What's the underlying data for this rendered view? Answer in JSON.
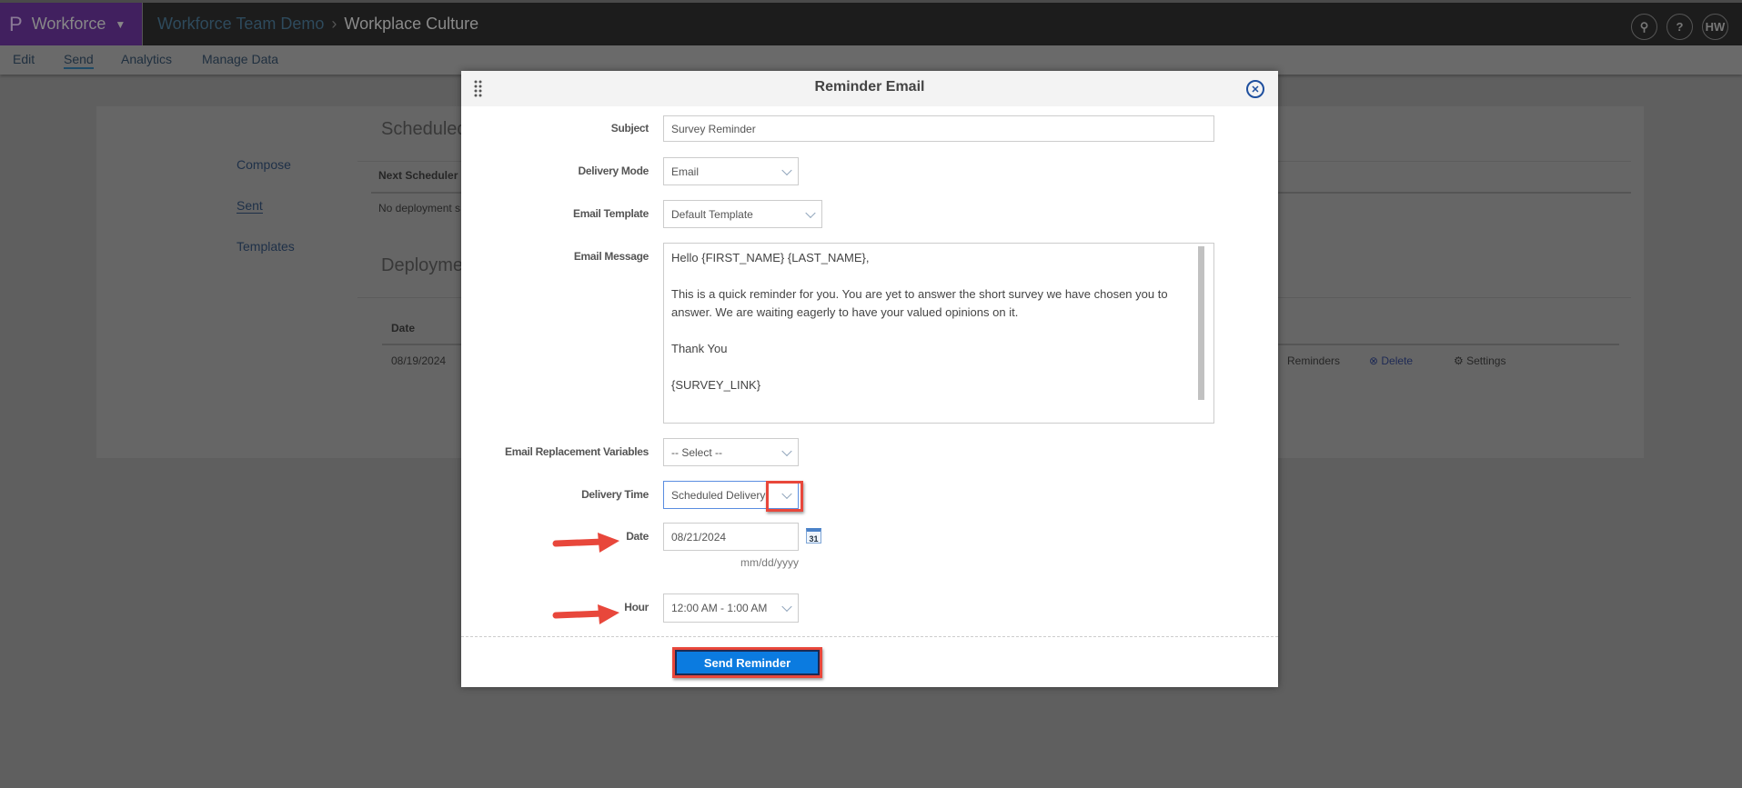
{
  "topbar": {
    "brand": "Workforce",
    "breadcrumb": [
      "Workforce Team Demo",
      "Workplace Culture"
    ],
    "icons": [
      "search-icon",
      "help-icon"
    ],
    "avatar_initials": "HW"
  },
  "nav": {
    "items": [
      "Edit",
      "Send",
      "Analytics",
      "Manage Data"
    ],
    "active": "Send"
  },
  "sidebar": {
    "items": [
      "Compose",
      "Sent",
      "Templates"
    ],
    "active": "Sent"
  },
  "background": {
    "scheduled_heading": "Scheduled",
    "next_scheduler_header": "Next Scheduler",
    "no_deployment_text": "No deployment s",
    "deployments_heading": "Deploymen",
    "date_header": "Date",
    "row_date": "08/19/2024",
    "actions": [
      "Reminders",
      "Delete",
      "Settings"
    ]
  },
  "modal": {
    "title": "Reminder Email",
    "subject_label": "Subject",
    "subject_value": "Survey Reminder",
    "delivery_mode_label": "Delivery Mode",
    "delivery_mode_value": "Email",
    "email_template_label": "Email Template",
    "email_template_value": "Default Template",
    "email_message_label": "Email Message",
    "email_message_value": "Hello {FIRST_NAME} {LAST_NAME},\n\nThis is a quick reminder for you. You are yet to answer the short survey we have chosen you to answer. We are waiting eagerly to have your valued opinions on it.\n\nThank You\n\n{SURVEY_LINK}",
    "replacement_vars_label": "Email Replacement Variables",
    "replacement_vars_value": "-- Select --",
    "delivery_time_label": "Delivery Time",
    "delivery_time_value": "Scheduled Delivery",
    "date_label": "Date",
    "date_value": "08/21/2024",
    "date_format_hint": "mm/dd/yyyy",
    "calendar_icon_text": "31",
    "hour_label": "Hour",
    "hour_value": "12:00 AM - 1:00 AM",
    "send_button": "Send Reminder"
  },
  "colors": {
    "accent": "#0b7be0",
    "annotation": "#e8473b",
    "brand": "#41205f"
  }
}
